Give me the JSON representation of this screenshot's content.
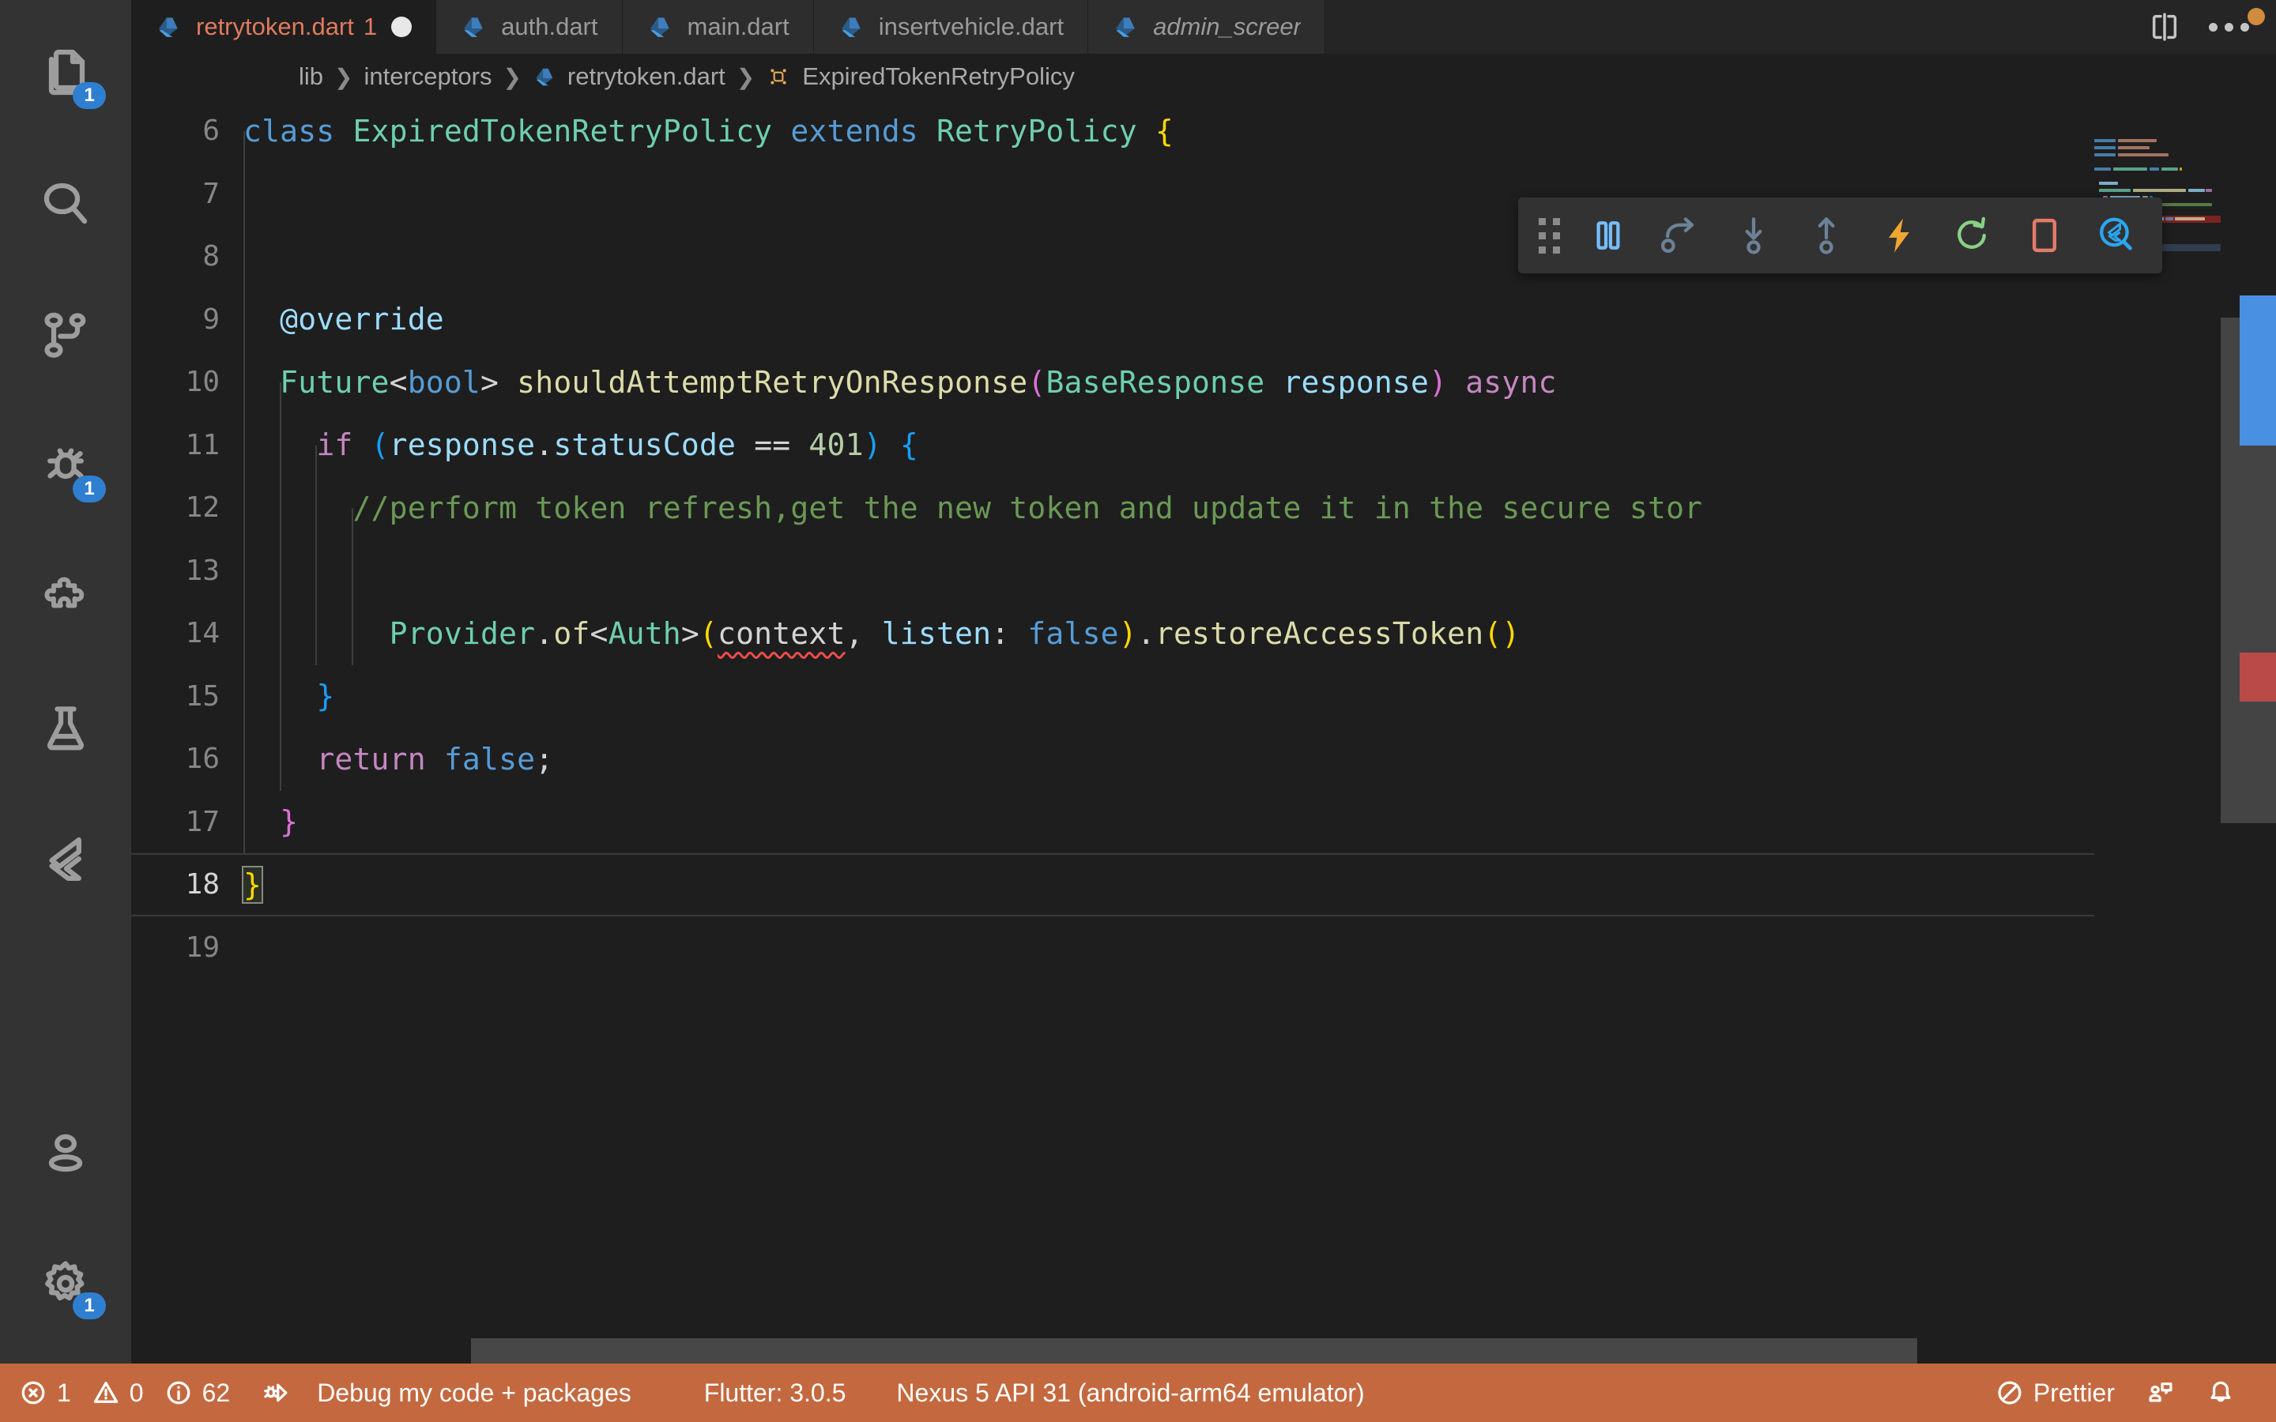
{
  "activity_bar": {
    "items": [
      {
        "name": "explorer",
        "icon": "files-icon",
        "badge": "1"
      },
      {
        "name": "search",
        "icon": "search-icon",
        "badge": null
      },
      {
        "name": "source-control",
        "icon": "source-control-icon",
        "badge": null
      },
      {
        "name": "run-and-debug",
        "icon": "debug-icon",
        "badge": "1"
      },
      {
        "name": "extensions",
        "icon": "extensions-icon",
        "badge": null
      },
      {
        "name": "testing",
        "icon": "beaker-icon",
        "badge": null
      },
      {
        "name": "flutter",
        "icon": "flutter-icon",
        "badge": null
      }
    ],
    "bottom_items": [
      {
        "name": "accounts",
        "icon": "account-icon",
        "badge": null
      },
      {
        "name": "manage-settings",
        "icon": "gear-icon",
        "badge": "1"
      }
    ]
  },
  "tabs": [
    {
      "label": "retrytoken.dart",
      "icon": "dart-icon",
      "error_count": "1",
      "active": true,
      "dirty": true,
      "preview": false
    },
    {
      "label": "auth.dart",
      "icon": "dart-icon",
      "error_count": "",
      "active": false,
      "dirty": false,
      "preview": false
    },
    {
      "label": "main.dart",
      "icon": "dart-icon",
      "error_count": "",
      "active": false,
      "dirty": false,
      "preview": false
    },
    {
      "label": "insertvehicle.dart",
      "icon": "dart-icon",
      "error_count": "",
      "active": false,
      "dirty": false,
      "preview": false
    },
    {
      "label": "admin_screen.dart",
      "icon": "dart-icon",
      "error_count": "",
      "active": false,
      "dirty": false,
      "preview": true
    }
  ],
  "tab_actions": [
    {
      "name": "split-editor-right-button",
      "icon": "split-editor-icon"
    },
    {
      "name": "more-actions-button",
      "icon": "ellipsis-icon"
    }
  ],
  "breadcrumbs": [
    {
      "label": "lib",
      "icon": null
    },
    {
      "label": "interceptors",
      "icon": null
    },
    {
      "label": "retrytoken.dart",
      "icon": "dart-icon"
    },
    {
      "label": "ExpiredTokenRetryPolicy",
      "icon": "class-symbol-icon"
    }
  ],
  "debug_toolbar": {
    "buttons": [
      {
        "name": "drag-handle",
        "icon": "grip-icon",
        "color": "#8b8b8b"
      },
      {
        "name": "pause-button",
        "icon": "pause-icon",
        "color": "#75beff"
      },
      {
        "name": "step-over-button",
        "icon": "step-over-icon",
        "color": "#6d8196"
      },
      {
        "name": "step-into-button",
        "icon": "step-into-icon",
        "color": "#6d8196"
      },
      {
        "name": "step-out-button",
        "icon": "step-out-icon",
        "color": "#6d8196"
      },
      {
        "name": "hot-reload-button",
        "icon": "lightning-icon",
        "color": "#f0a732"
      },
      {
        "name": "hot-restart-button",
        "icon": "restart-icon",
        "color": "#89d185"
      },
      {
        "name": "stop-button",
        "icon": "stop-icon",
        "color": "#e57b6a"
      },
      {
        "name": "flutter-inspector-button",
        "icon": "flutter-inspect-icon",
        "color": "#2aa7f0"
      }
    ]
  },
  "editor": {
    "first_line": 6,
    "cursor_line": 18,
    "lines": [
      {
        "num": 6,
        "tokens": [
          {
            "t": "class",
            "c": "t-kw2"
          },
          {
            "t": " ",
            "c": "t-op"
          },
          {
            "t": "ExpiredTokenRetryPolicy",
            "c": "t-type"
          },
          {
            "t": " ",
            "c": "t-op"
          },
          {
            "t": "extends",
            "c": "t-kw2"
          },
          {
            "t": " ",
            "c": "t-op"
          },
          {
            "t": "RetryPolicy",
            "c": "t-type"
          },
          {
            "t": " ",
            "c": "t-op"
          },
          {
            "t": "{",
            "c": "t-b1"
          }
        ]
      },
      {
        "num": 7,
        "tokens": []
      },
      {
        "num": 8,
        "tokens": []
      },
      {
        "num": 9,
        "tokens": [
          {
            "t": "  @override",
            "c": "t-var"
          }
        ]
      },
      {
        "num": 10,
        "tokens": [
          {
            "t": "  ",
            "c": "t-op"
          },
          {
            "t": "Future",
            "c": "t-type"
          },
          {
            "t": "<",
            "c": "t-op"
          },
          {
            "t": "bool",
            "c": "t-kw2"
          },
          {
            "t": ">",
            "c": "t-op"
          },
          {
            "t": " ",
            "c": "t-op"
          },
          {
            "t": "shouldAttemptRetryOnResponse",
            "c": "t-fn"
          },
          {
            "t": "(",
            "c": "t-b2"
          },
          {
            "t": "BaseResponse",
            "c": "t-type"
          },
          {
            "t": " ",
            "c": "t-op"
          },
          {
            "t": "response",
            "c": "t-var"
          },
          {
            "t": ")",
            "c": "t-b2"
          },
          {
            "t": " ",
            "c": "t-op"
          },
          {
            "t": "async",
            "c": "t-kw"
          }
        ]
      },
      {
        "num": 11,
        "tokens": [
          {
            "t": "    ",
            "c": "t-op"
          },
          {
            "t": "if",
            "c": "t-kw"
          },
          {
            "t": " ",
            "c": "t-op"
          },
          {
            "t": "(",
            "c": "t-b3"
          },
          {
            "t": "response",
            "c": "t-var"
          },
          {
            "t": ".",
            "c": "t-op"
          },
          {
            "t": "statusCode",
            "c": "t-var"
          },
          {
            "t": " ",
            "c": "t-op"
          },
          {
            "t": "==",
            "c": "t-op"
          },
          {
            "t": " ",
            "c": "t-op"
          },
          {
            "t": "401",
            "c": "t-num"
          },
          {
            "t": ")",
            "c": "t-b3"
          },
          {
            "t": " ",
            "c": "t-op"
          },
          {
            "t": "{",
            "c": "t-b3"
          }
        ]
      },
      {
        "num": 12,
        "tokens": [
          {
            "t": "      //perform token refresh,get the new token and update it in the secure stor",
            "c": "t-cmt"
          }
        ]
      },
      {
        "num": 13,
        "tokens": []
      },
      {
        "num": 14,
        "tokens": [
          {
            "t": "        ",
            "c": "t-op"
          },
          {
            "t": "Provider",
            "c": "t-type"
          },
          {
            "t": ".",
            "c": "t-op"
          },
          {
            "t": "of",
            "c": "t-fn"
          },
          {
            "t": "<",
            "c": "t-op"
          },
          {
            "t": "Auth",
            "c": "t-type"
          },
          {
            "t": ">",
            "c": "t-op"
          },
          {
            "t": "(",
            "c": "t-b1"
          },
          {
            "t": "context",
            "c": "t-op",
            "squiggle": true
          },
          {
            "t": ", ",
            "c": "t-op"
          },
          {
            "t": "listen",
            "c": "t-var"
          },
          {
            "t": ": ",
            "c": "t-op"
          },
          {
            "t": "false",
            "c": "t-kw2"
          },
          {
            "t": ")",
            "c": "t-b1"
          },
          {
            "t": ".",
            "c": "t-op"
          },
          {
            "t": "restoreAccessToken",
            "c": "t-fn"
          },
          {
            "t": "(",
            "c": "t-b1"
          },
          {
            "t": ")",
            "c": "t-b1"
          }
        ]
      },
      {
        "num": 15,
        "tokens": [
          {
            "t": "    ",
            "c": "t-op"
          },
          {
            "t": "}",
            "c": "t-b3"
          }
        ]
      },
      {
        "num": 16,
        "tokens": [
          {
            "t": "    ",
            "c": "t-op"
          },
          {
            "t": "return",
            "c": "t-kw"
          },
          {
            "t": " ",
            "c": "t-op"
          },
          {
            "t": "false",
            "c": "t-kw2"
          },
          {
            "t": ";",
            "c": "t-op"
          }
        ]
      },
      {
        "num": 17,
        "tokens": [
          {
            "t": "  ",
            "c": "t-op"
          },
          {
            "t": "}",
            "c": "t-b2"
          }
        ]
      },
      {
        "num": 18,
        "tokens": [
          {
            "t": "}",
            "c": "t-b1",
            "bracketbox": true
          }
        ]
      },
      {
        "num": 19,
        "tokens": []
      }
    ]
  },
  "status_bar": {
    "problems": {
      "errors": "1",
      "warnings": "0",
      "infos": "62"
    },
    "debug_session": "Debug my code + packages",
    "flutter_version": "Flutter: 3.0.5",
    "device": "Nexus 5 API 31 (android-arm64 emulator)",
    "formatter": "Prettier",
    "right_icons": [
      {
        "name": "live-share-button",
        "icon": "remote-share-icon"
      },
      {
        "name": "notifications-button",
        "icon": "bell-icon"
      }
    ]
  },
  "colors": {
    "status_bar_debug": "#c4693f",
    "accent_blue": "#2f7fd1",
    "error_red": "#f14c4c",
    "tab_active_text": "#e07a5f",
    "editor_bg": "#1e1e1e",
    "activity_bar_bg": "#333333",
    "tabbar_bg": "#252526"
  }
}
